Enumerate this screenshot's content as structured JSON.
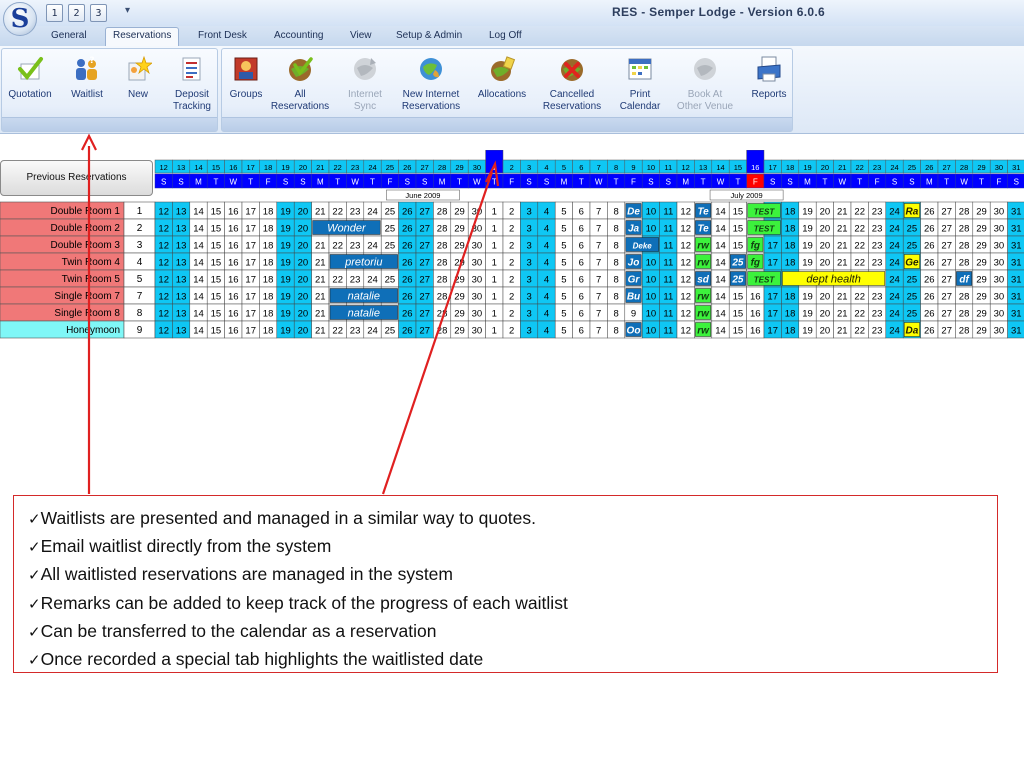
{
  "window": {
    "title": "RES - Semper Lodge - Version 6.0.6",
    "orb_letter": "S",
    "quick_access": [
      "1",
      "2",
      "3"
    ],
    "qat_caret": "▾"
  },
  "tabs": [
    {
      "label": "General",
      "active": false
    },
    {
      "label": "Reservations",
      "active": true
    },
    {
      "label": "Front Desk",
      "active": false
    },
    {
      "label": "Accounting",
      "active": false
    },
    {
      "label": "View",
      "active": false
    },
    {
      "label": "Setup & Admin",
      "active": false
    },
    {
      "label": "Log Off",
      "active": false
    }
  ],
  "ribbon": {
    "group1": [
      {
        "label": "Quotation",
        "icon": "quotation-checkmark-icon",
        "enabled": true
      },
      {
        "label": "Waitlist",
        "icon": "waitlist-people-icon",
        "enabled": true
      },
      {
        "label": "New",
        "icon": "new-star-icon",
        "enabled": true
      },
      {
        "label": "Deposit\nTracking",
        "icon": "deposit-tracking-icon",
        "enabled": true
      }
    ],
    "group2": [
      {
        "label": "Groups",
        "icon": "groups-icon",
        "enabled": true
      },
      {
        "label": "All\nReservations",
        "icon": "all-reservations-globe-icon",
        "enabled": true
      },
      {
        "label": "Internet\nSync",
        "icon": "internet-sync-icon",
        "enabled": false
      },
      {
        "label": "New Internet\nReservations",
        "icon": "internet-reservations-icon",
        "enabled": true
      },
      {
        "label": "Allocations",
        "icon": "allocations-icon",
        "enabled": true
      },
      {
        "label": "Cancelled\nReservations",
        "icon": "cancelled-reservations-icon",
        "enabled": true
      },
      {
        "label": "Print\nCalendar",
        "icon": "print-calendar-icon",
        "enabled": true
      },
      {
        "label": "Book At\nOther Venue",
        "icon": "book-other-venue-icon",
        "enabled": false
      },
      {
        "label": "Reports",
        "icon": "reports-printer-icon",
        "enabled": true
      }
    ]
  },
  "calendar": {
    "previous_button": "Previous Reservations",
    "months": [
      {
        "label": "June 2009",
        "first_day": 12,
        "last_day": 30,
        "first_weekday": 5
      },
      {
        "label": "July 2009",
        "first_day": 1,
        "last_day": 31,
        "first_weekday": 3
      }
    ],
    "weekday_letters": [
      "M",
      "T",
      "W",
      "T",
      "F",
      "S",
      "S"
    ],
    "highlight_header_days": [
      {
        "month": 1,
        "day": 1,
        "color": "#0000ff"
      },
      {
        "month": 1,
        "day": 16,
        "color": "#0000ff"
      }
    ],
    "highlight_weekday_cell": {
      "month": 1,
      "day": 16,
      "color": "#ff0000"
    },
    "rooms": [
      {
        "name": "Double Room 1",
        "number": "1",
        "color": "#f07878"
      },
      {
        "name": "Double Room 2",
        "number": "2",
        "color": "#f07878"
      },
      {
        "name": "Double Room 3",
        "number": "3",
        "color": "#f07878"
      },
      {
        "name": "Twin Room 4",
        "number": "4",
        "color": "#f07878"
      },
      {
        "name": "Twin Room 5",
        "number": "5",
        "color": "#f07878"
      },
      {
        "name": "Single Room 7",
        "number": "7",
        "color": "#f07878"
      },
      {
        "name": "Single Room 8",
        "number": "8",
        "color": "#f07878"
      },
      {
        "name": "Honeymoon",
        "number": "9",
        "color": "#7ff7f7"
      }
    ],
    "bookings": [
      {
        "row": 0,
        "month": 1,
        "start": 9,
        "span": 1,
        "label": "De",
        "style": "blue"
      },
      {
        "row": 0,
        "month": 1,
        "start": 13,
        "span": 1,
        "label": "Te",
        "style": "blue"
      },
      {
        "row": 0,
        "month": 1,
        "start": 16,
        "span": 2,
        "label": "TEST",
        "style": "green"
      },
      {
        "row": 0,
        "month": 1,
        "start": 25,
        "span": 1,
        "label": "Ra",
        "style": "yellow"
      },
      {
        "row": 1,
        "month": 0,
        "start": 21,
        "span": 4,
        "label": "Wonder",
        "style": "blue"
      },
      {
        "row": 1,
        "month": 1,
        "start": 9,
        "span": 1,
        "label": "Ja",
        "style": "blue"
      },
      {
        "row": 1,
        "month": 1,
        "start": 13,
        "span": 1,
        "label": "Te",
        "style": "blue"
      },
      {
        "row": 1,
        "month": 1,
        "start": 16,
        "span": 2,
        "label": "TEST",
        "style": "green"
      },
      {
        "row": 2,
        "month": 1,
        "start": 9,
        "span": 2,
        "label": "Deke",
        "style": "blue"
      },
      {
        "row": 2,
        "month": 1,
        "start": 13,
        "span": 1,
        "label": "rw",
        "style": "green"
      },
      {
        "row": 2,
        "month": 1,
        "start": 16,
        "span": 1,
        "label": "fg",
        "style": "green"
      },
      {
        "row": 3,
        "month": 0,
        "start": 22,
        "span": 4,
        "label": "pretoriu",
        "style": "blue"
      },
      {
        "row": 3,
        "month": 1,
        "start": 9,
        "span": 1,
        "label": "Jo",
        "style": "blue"
      },
      {
        "row": 3,
        "month": 1,
        "start": 13,
        "span": 1,
        "label": "rw",
        "style": "green"
      },
      {
        "row": 3,
        "month": 1,
        "start": 15,
        "span": 1,
        "label": "25",
        "style": "blue"
      },
      {
        "row": 3,
        "month": 1,
        "start": 16,
        "span": 1,
        "label": "fg",
        "style": "green"
      },
      {
        "row": 3,
        "month": 1,
        "start": 25,
        "span": 1,
        "label": "Ge",
        "style": "yellow"
      },
      {
        "row": 4,
        "month": 1,
        "start": 9,
        "span": 1,
        "label": "Gr",
        "style": "blue"
      },
      {
        "row": 4,
        "month": 1,
        "start": 13,
        "span": 1,
        "label": "sd",
        "style": "blue"
      },
      {
        "row": 4,
        "month": 1,
        "start": 15,
        "span": 1,
        "label": "25",
        "style": "blue"
      },
      {
        "row": 4,
        "month": 1,
        "start": 16,
        "span": 2,
        "label": "TEST",
        "style": "green"
      },
      {
        "row": 4,
        "month": 1,
        "start": 18,
        "span": 6,
        "label": "dept health",
        "style": "yellow"
      },
      {
        "row": 4,
        "month": 1,
        "start": 28,
        "span": 1,
        "label": "df",
        "style": "blue"
      },
      {
        "row": 5,
        "month": 0,
        "start": 22,
        "span": 4,
        "label": "natalie",
        "style": "blue"
      },
      {
        "row": 5,
        "month": 1,
        "start": 9,
        "span": 1,
        "label": "Bu",
        "style": "blue"
      },
      {
        "row": 5,
        "month": 1,
        "start": 13,
        "span": 1,
        "label": "rw",
        "style": "green"
      },
      {
        "row": 6,
        "month": 0,
        "start": 22,
        "span": 4,
        "label": "natalie",
        "style": "blue"
      },
      {
        "row": 6,
        "month": 1,
        "start": 13,
        "span": 1,
        "label": "rw",
        "style": "green"
      },
      {
        "row": 7,
        "month": 1,
        "start": 9,
        "span": 1,
        "label": "Oo",
        "style": "blue"
      },
      {
        "row": 7,
        "month": 1,
        "start": 13,
        "span": 1,
        "label": "rw",
        "style": "green"
      },
      {
        "row": 7,
        "month": 1,
        "start": 25,
        "span": 1,
        "label": "Da",
        "style": "yellow"
      }
    ]
  },
  "notes": [
    "Waitlists are presented and managed in a similar way to quotes.",
    "Email waitlist directly from the system",
    "All waitlisted reservations are managed in the system",
    "Remarks can be added to keep track of the progress of each waitlist",
    "Can be transferred to the calendar as a reservation",
    "Once recorded a special tab highlights the waitlisted date"
  ],
  "check_mark": "✓",
  "colors": {
    "weekend": "#0fc7f4",
    "header_blue": "#0000ff",
    "booking_blue": "#0f6fb8",
    "booking_green": "#3cf23c",
    "booking_yellow": "#ffff00",
    "arrow_red": "#e02020"
  }
}
